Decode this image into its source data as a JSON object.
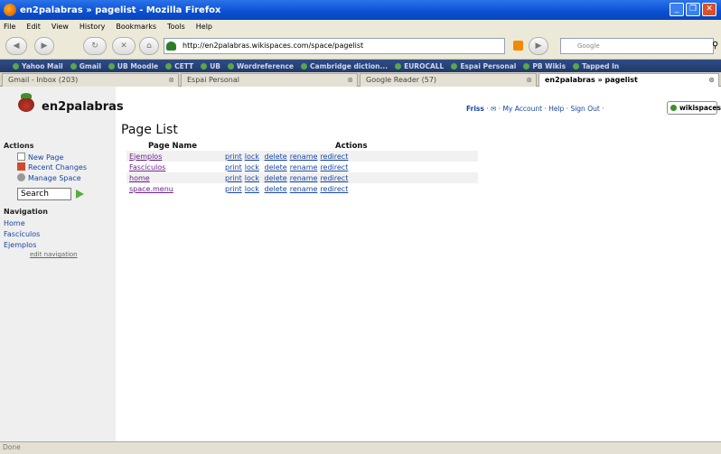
{
  "window": {
    "title": "en2palabras » pagelist - Mozilla Firefox"
  },
  "menu": [
    "File",
    "Edit",
    "View",
    "History",
    "Bookmarks",
    "Tools",
    "Help"
  ],
  "nav": {
    "url": "http://en2palabras.wikispaces.com/space/pagelist",
    "search_placeholder": "Google"
  },
  "bookmarks": [
    "Yahoo Mail",
    "Gmail",
    "UB Moodle",
    "CETT",
    "UB",
    "Wordreference",
    "Cambridge diction...",
    "EUROCALL",
    "Espai Personal",
    "PB Wikis",
    "Tapped In"
  ],
  "tabs": [
    {
      "label": "Gmail - Inbox (203)"
    },
    {
      "label": "Espai Personal"
    },
    {
      "label": "Google Reader (57)"
    },
    {
      "label": "en2palabras » pagelist"
    }
  ],
  "site": {
    "name": "en2palabras"
  },
  "toplinks": {
    "user": "Friss",
    "account": "My Account",
    "help": "Help",
    "signout": "Sign Out",
    "badge": "wikispaces"
  },
  "sidebar": {
    "actions_heading": "Actions",
    "actions": [
      "New Page",
      "Recent Changes",
      "Manage Space"
    ],
    "search_value": "Search",
    "nav_heading": "Navigation",
    "nav": [
      "Home",
      "Fascículos",
      "Ejemplos"
    ],
    "edit_nav": "edit navigation"
  },
  "page": {
    "title": "Page List",
    "col_name": "Page Name",
    "col_actions": "Actions",
    "rows": [
      {
        "name": "Ejemplos"
      },
      {
        "name": "Fascículos"
      },
      {
        "name": "home"
      },
      {
        "name": "space.menu"
      }
    ],
    "actions": [
      "print",
      "lock",
      "delete",
      "rename",
      "redirect"
    ]
  },
  "status": {
    "text": "Done"
  }
}
